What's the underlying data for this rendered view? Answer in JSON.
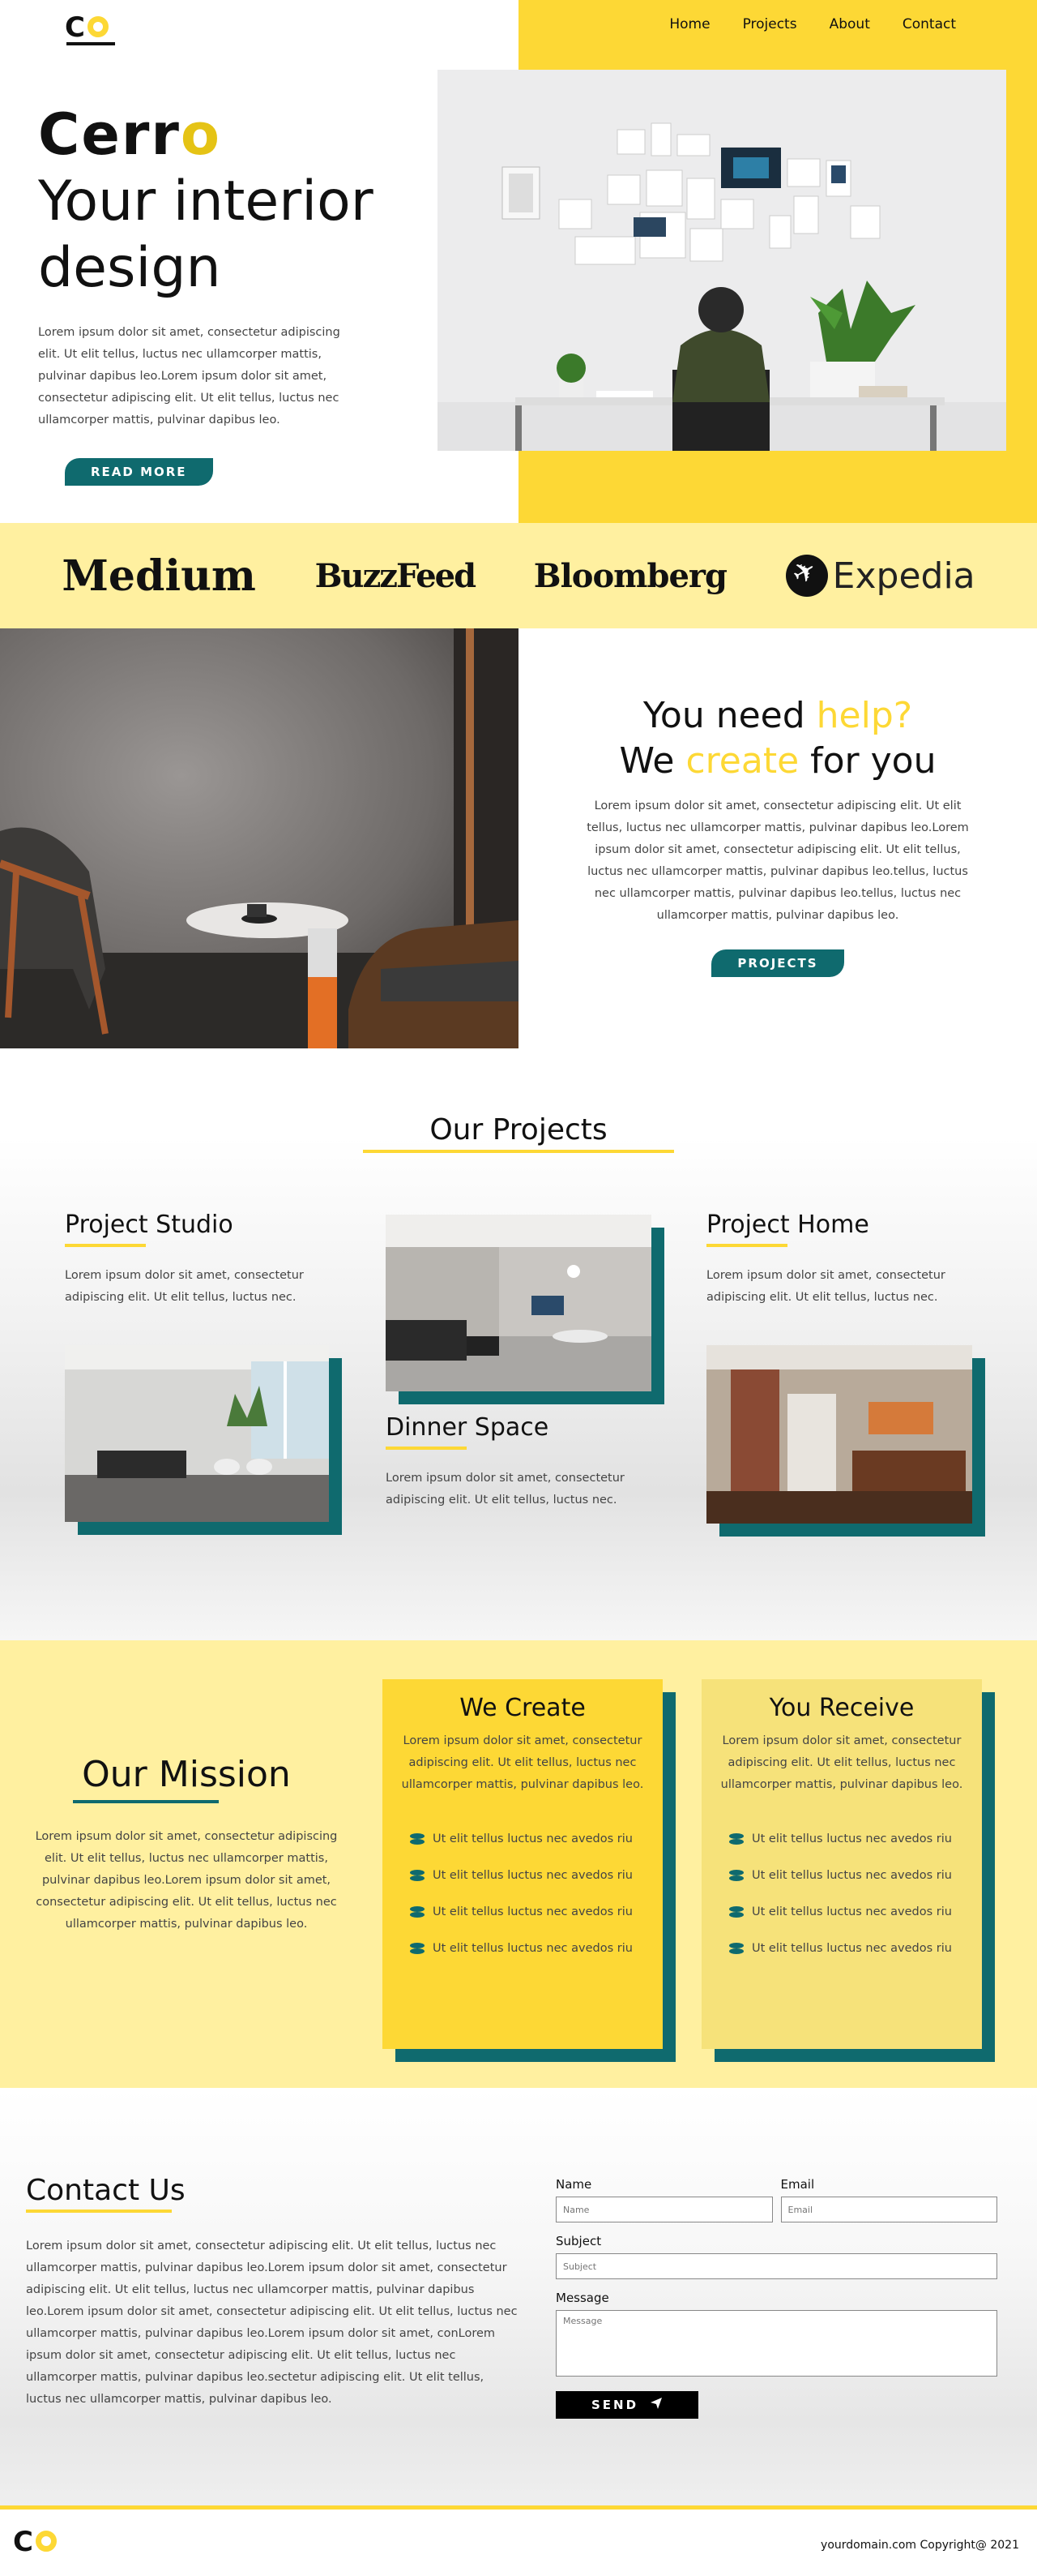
{
  "logo": {
    "letter": "C"
  },
  "nav": {
    "home": "Home",
    "projects": "Projects",
    "about": "About",
    "contact": "Contact"
  },
  "hero": {
    "brand_main": "Cerr",
    "brand_accent": "o",
    "tagline_line1": "Your interior",
    "tagline_line2": "design",
    "text": "Lorem ipsum dolor sit amet, consectetur adipiscing elit. Ut elit tellus, luctus nec ullamcorper mattis, pulvinar dapibus leo.Lorem ipsum dolor sit amet, consectetur adipiscing elit. Ut elit tellus, luctus nec ullamcorper mattis, pulvinar dapibus leo.",
    "button": "READ MORE"
  },
  "partners": [
    "Medium",
    "BuzzFeed",
    "Bloomberg",
    "Expedia"
  ],
  "help": {
    "line1_pre": "You need ",
    "line1_accent": "help?",
    "line2_pre": "We ",
    "line2_accent": "create",
    "line2_post": " for you",
    "text": "Lorem ipsum dolor sit amet, consectetur adipiscing elit. Ut elit tellus, luctus nec ullamcorper mattis, pulvinar dapibus leo.Lorem ipsum dolor sit amet, consectetur adipiscing elit. Ut elit tellus, luctus nec ullamcorper mattis, pulvinar dapibus leo.tellus, luctus nec ullamcorper mattis, pulvinar dapibus leo.tellus, luctus nec ullamcorper mattis, pulvinar dapibus leo.",
    "button": "PROJECTS"
  },
  "projects": {
    "title": "Our Projects",
    "studio": {
      "title": "Project Studio",
      "text": "Lorem ipsum dolor sit amet, consectetur adipiscing elit. Ut elit tellus, luctus nec."
    },
    "dinner": {
      "title": "Dinner Space",
      "text": "Lorem ipsum dolor sit amet, consectetur adipiscing elit. Ut elit tellus, luctus nec."
    },
    "home": {
      "title": "Project Home",
      "text": "Lorem ipsum dolor sit amet, consectetur adipiscing elit. Ut elit tellus, luctus nec."
    }
  },
  "mission": {
    "title": "Our Mission",
    "text": "Lorem ipsum dolor sit amet, consectetur adipiscing elit. Ut elit tellus, luctus nec ullamcorper mattis, pulvinar dapibus leo.Lorem ipsum dolor sit amet, consectetur adipiscing elit. Ut elit tellus, luctus nec ullamcorper mattis, pulvinar dapibus leo.",
    "create": {
      "title": "We Create",
      "text": "Lorem ipsum dolor sit amet, consectetur adipiscing elit. Ut elit tellus, luctus nec ullamcorper mattis, pulvinar dapibus leo.",
      "items": [
        "Ut elit tellus luctus nec avedos riu",
        "Ut elit tellus luctus nec avedos riu",
        "Ut elit tellus luctus nec avedos riu",
        "Ut elit tellus luctus nec avedos riu"
      ]
    },
    "receive": {
      "title": "You Receive",
      "text": "Lorem ipsum dolor sit amet, consectetur adipiscing elit. Ut elit tellus, luctus nec ullamcorper mattis, pulvinar dapibus leo.",
      "items": [
        "Ut elit tellus luctus nec avedos riu",
        "Ut elit tellus luctus nec avedos riu",
        "Ut elit tellus luctus nec avedos riu",
        "Ut elit tellus luctus nec avedos riu"
      ]
    }
  },
  "contact": {
    "title": "Contact Us",
    "text": "Lorem ipsum dolor sit amet, consectetur adipiscing elit. Ut elit tellus, luctus nec ullamcorper mattis, pulvinar dapibus leo.Lorem ipsum dolor sit amet, consectetur adipiscing elit. Ut elit tellus, luctus nec ullamcorper mattis, pulvinar dapibus leo.Lorem ipsum dolor sit amet, consectetur adipiscing elit. Ut elit tellus, luctus nec ullamcorper mattis, pulvinar dapibus leo.Lorem ipsum dolor sit amet, conLorem ipsum dolor sit amet, consectetur adipiscing elit. Ut elit tellus, luctus nec ullamcorper mattis, pulvinar dapibus leo.sectetur adipiscing elit. Ut elit tellus, luctus nec ullamcorper mattis, pulvinar dapibus leo.",
    "form": {
      "name_label": "Name",
      "name_placeholder": "Name",
      "email_label": "Email",
      "email_placeholder": "Email",
      "subject_label": "Subject",
      "subject_placeholder": "Subject",
      "message_label": "Message",
      "message_placeholder": "Message",
      "send": "SEND"
    }
  },
  "footer": {
    "copyright": "yourdomain.com Copyright@ 2021"
  },
  "colors": {
    "yellow": "#fdd835",
    "teal": "#0f6a6e",
    "pale_yellow": "#fff0a0"
  }
}
